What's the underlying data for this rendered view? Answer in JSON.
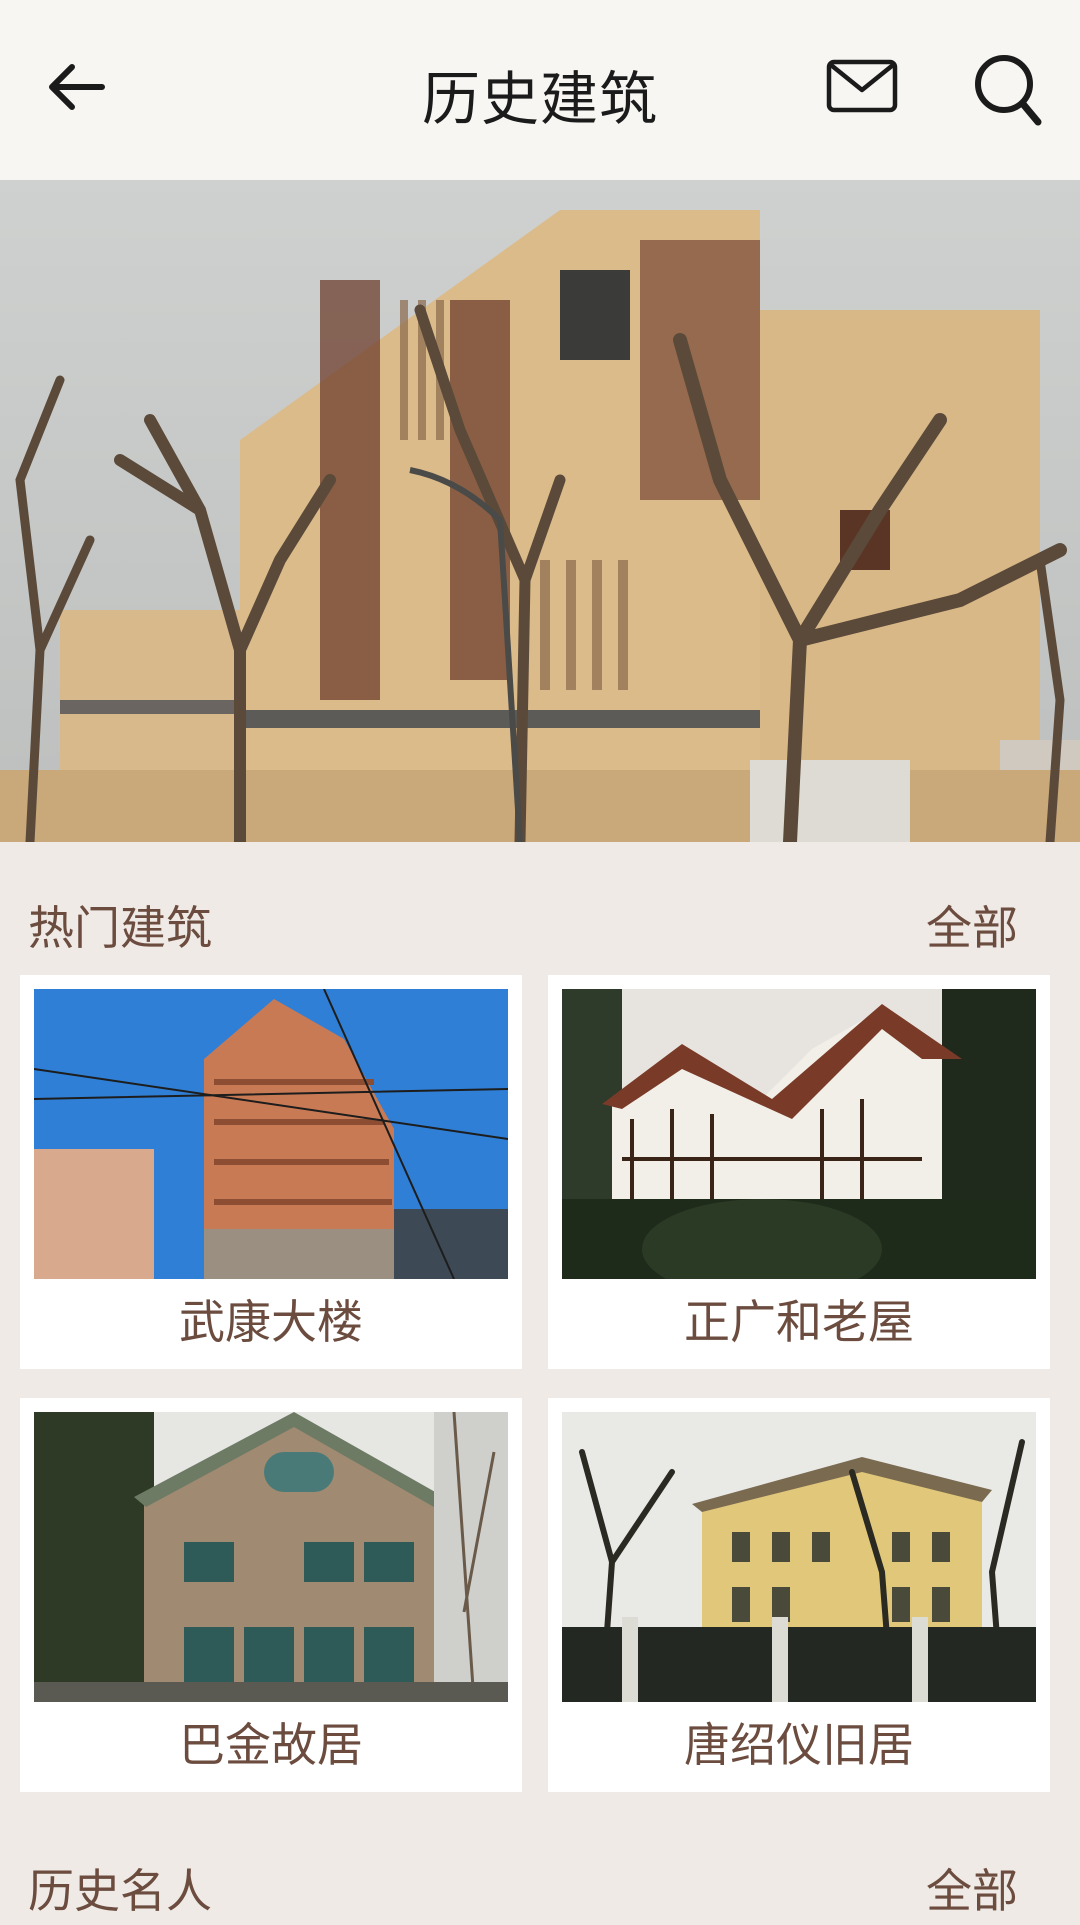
{
  "header": {
    "title": "历史建筑",
    "back_icon": "back-arrow-icon",
    "mail_icon": "mail-icon",
    "search_icon": "search-icon"
  },
  "banner": {
    "slide_count": 4,
    "active_index": 1
  },
  "sections": [
    {
      "title": "热门建筑",
      "more": "全部"
    },
    {
      "title": "历史名人",
      "more": "全部"
    }
  ],
  "buildings": [
    {
      "name": "武康大楼"
    },
    {
      "name": "正广和老屋"
    },
    {
      "name": "巴金故居"
    },
    {
      "name": "唐绍仪旧居"
    }
  ],
  "colors": {
    "background": "#efeae5",
    "header_bg": "#f8f6f3",
    "accent_text": "#6b4c3f",
    "title_text": "#1b1b1b"
  }
}
